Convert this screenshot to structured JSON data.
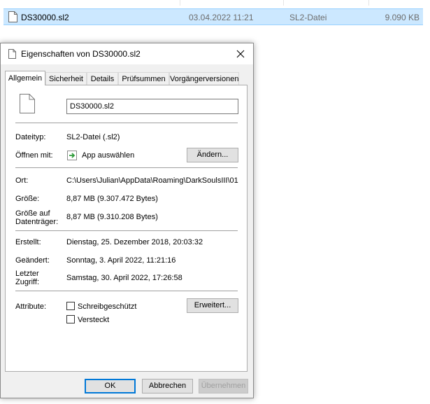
{
  "explorer_row": {
    "name": "DS30000.sl2",
    "modified": "03.04.2022 11:21",
    "type": "SL2-Datei",
    "size": "9.090 KB"
  },
  "dialog": {
    "title": "Eigenschaften von DS30000.sl2",
    "tabs": [
      {
        "label": "Allgemein",
        "active": true
      },
      {
        "label": "Sicherheit"
      },
      {
        "label": "Details"
      },
      {
        "label": "Prüfsummen"
      },
      {
        "label": "Vorgängerversionen"
      }
    ],
    "filename": "DS30000.sl2",
    "fields": {
      "dateityp_label": "Dateityp:",
      "dateityp_value": "SL2-Datei (.sl2)",
      "oeffnen_label": "Öffnen mit:",
      "oeffnen_value": "App auswählen",
      "aendern_button": "Ändern...",
      "ort_label": "Ort:",
      "ort_value": "C:\\Users\\Julian\\AppData\\Roaming\\DarkSoulsIII\\01",
      "groesse_label": "Größe:",
      "groesse_value": "8,87 MB (9.307.472 Bytes)",
      "groesse_auf_label_1": "Größe auf",
      "groesse_auf_label_2": "Datenträger:",
      "groesse_auf_value": "8,87 MB (9.310.208 Bytes)",
      "erstellt_label": "Erstellt:",
      "erstellt_value": "Dienstag, 25. Dezember 2018, 20:03:32",
      "geaendert_label": "Geändert:",
      "geaendert_value": "Sonntag, 3. April 2022, 11:21:16",
      "zugriff_label_1": "Letzter",
      "zugriff_label_2": "Zugriff:",
      "zugriff_value": "Samstag, 30. April 2022, 17:26:58",
      "attribute_label": "Attribute:",
      "schreibgeschuetzt": "Schreibgeschützt",
      "versteckt": "Versteckt",
      "erweitert_button": "Erweitert..."
    },
    "buttons": {
      "ok": "OK",
      "abbrechen": "Abbrechen",
      "uebernehmen": "Übernehmen"
    }
  },
  "icons": {
    "file": "file-icon",
    "close": "close-icon",
    "app": "app-arrow-icon"
  },
  "colors": {
    "selection": "#cce8ff",
    "dialog_bg": "#f0f0f0",
    "accent": "#0078d7",
    "app_icon_green": "#2e9b3a"
  }
}
